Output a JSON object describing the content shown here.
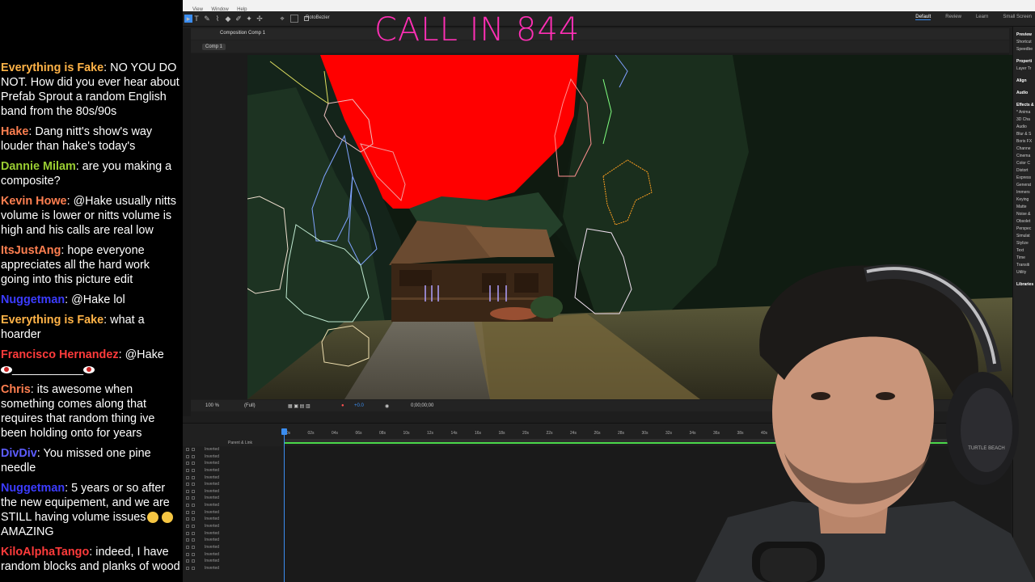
{
  "banner": {
    "text": "CALL IN 844"
  },
  "chat": {
    "messages": [
      {
        "user": "Everything is Fake",
        "color": "#ffb347",
        "text": "NO YOU DO NOT. How did you ever hear about Prefab Sprout a random English band from the 80s/90s"
      },
      {
        "user": "Hake",
        "color": "#ff7f50",
        "text": "Dang nitt's show's way louder than hake's today's"
      },
      {
        "user": "Dannie Milam",
        "color": "#9acd32",
        "text": "are you making a composite?"
      },
      {
        "user": "Kevin Howe",
        "color": "#ff7f50",
        "text": "@Hake usually nitts volume is lower or nitts volume is high and his calls are real low"
      },
      {
        "user": "ItsJustAng",
        "color": "#ff7f50",
        "text": "hope everyone appreciates all the hard work going into this picture edit"
      },
      {
        "user": "Nuggetman",
        "color": "#3c3cff",
        "text": "@Hake lol"
      },
      {
        "user": "Everything is Fake",
        "color": "#ffb347",
        "text": "what a hoarder"
      },
      {
        "user": "Francisco Hernandez",
        "color": "#ff3b3b",
        "text": "@Hake",
        "line2": "___________"
      },
      {
        "user": "Chris",
        "color": "#ff7f50",
        "text": "its awesome when something comes along that requires that random thing ive been holding onto for years"
      },
      {
        "user": "DivDiv",
        "color": "#5c5cff",
        "text": "You missed one pine needle"
      },
      {
        "user": "Nuggetman",
        "color": "#3c3cff",
        "text": "5 years or so after the new equipement, and we are STILL having volume issues",
        "tail": "AMAZING"
      },
      {
        "user": "KiloAlphaTango",
        "color": "#ff3b3b",
        "text": "indeed, I have random blocks and planks of wood"
      }
    ]
  },
  "app": {
    "menu": [
      "",
      "View",
      "Window",
      "Help"
    ],
    "roto_label": "RotoBezier",
    "workspaces": [
      "Default",
      "Review",
      "Learn",
      "Small Screen"
    ],
    "comp_tab": "Composition Comp 1",
    "comp_chip": "Comp 1",
    "viewer": {
      "zoom": "100 %",
      "resolution": "(Full)",
      "offset": "+0.0",
      "timecode": "0;00;00;00"
    },
    "right_panel": {
      "items": [
        "Preview",
        "Shortcut",
        "Speedbe",
        "Properti",
        "Layer Tr",
        "Align",
        "Audio",
        "Effects &",
        "* Anima",
        "3D Cha",
        "Audio",
        "Blur & S",
        "Boris FX",
        "Channe",
        "Cinema",
        "Color C",
        "Distort",
        "Express",
        "Generat",
        "Immers",
        "Keying",
        "Matte",
        "Noise &",
        "Obsolet",
        "Perspec",
        "Simulat",
        "Stylize",
        "Text",
        "Time",
        "Transiti",
        "Utility",
        "Libraries"
      ]
    },
    "timeline": {
      "parent_label": "Parent & Link",
      "ticks": [
        "00s",
        "02s",
        "04s",
        "06s",
        "08s",
        "10s",
        "12s",
        "14s",
        "16s",
        "18s",
        "20s",
        "22s",
        "24s",
        "26s",
        "28s",
        "30s",
        "32s",
        "34s",
        "36s",
        "38s",
        "40s"
      ],
      "layer_label": "Inverted",
      "layer_count": 18
    }
  },
  "webcam": {
    "headset_brand": "TURTLE BEACH"
  },
  "colors": {
    "accent": "#3b8df0",
    "banner": "#ff2fb5",
    "mask_red": "#ff0000",
    "timeline_green": "#4ad84a"
  }
}
